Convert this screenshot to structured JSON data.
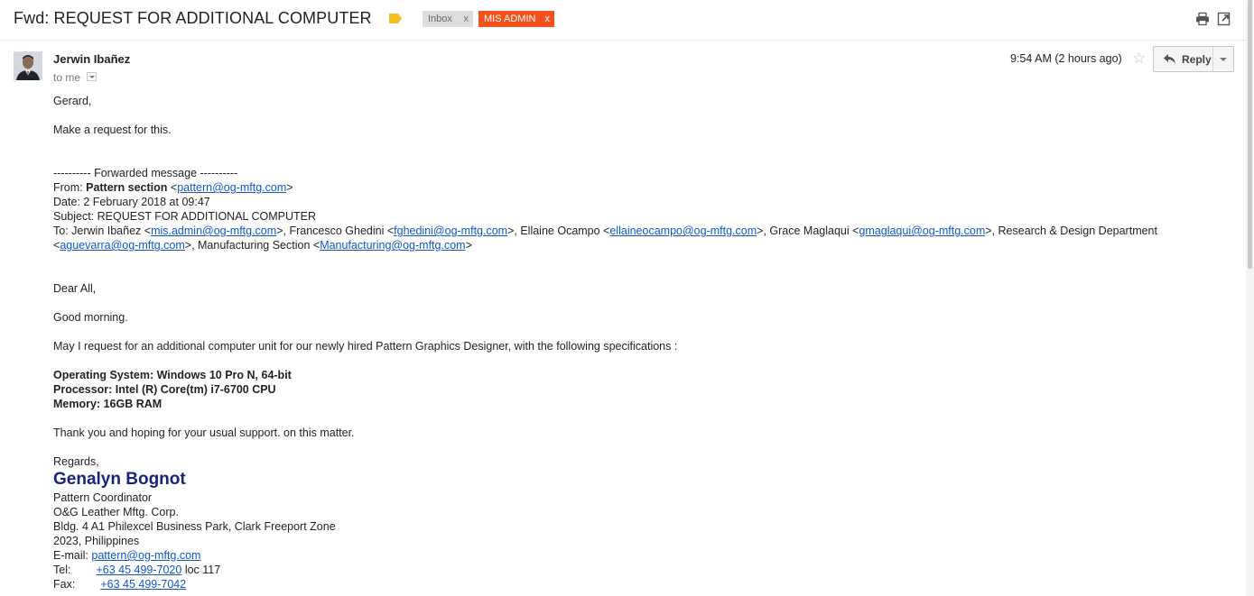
{
  "subject": {
    "title": "Fwd: REQUEST FOR ADDITIONAL COMPUTER",
    "labels": [
      {
        "name": "Inbox",
        "remove": "x"
      },
      {
        "name": "MIS ADMIN",
        "remove": "x"
      }
    ]
  },
  "icons": {
    "label_tag": "label-tag-icon",
    "print": "print-icon",
    "new_window": "new-window-icon",
    "star": "star-icon",
    "reply": "reply-arrow-icon"
  },
  "colors": {
    "label_tag": "#f6bf26",
    "mis_admin_label": "#f4511e",
    "inbox_label": "#dddddd",
    "link": "#1155cc",
    "signature_name": "#1a237e"
  },
  "message": {
    "sender_name": "Jerwin Ibañez",
    "to": "to me",
    "time": "9:54 AM (2 hours ago)",
    "star": "☆",
    "reply_label": "Reply"
  },
  "body": {
    "greeting": "Gerard,",
    "line1": "Make a request for this.",
    "fwd_header": "---------- Forwarded message ----------",
    "from_label": "From: ",
    "from_name": "Pattern section",
    "from_email": "pattern@og-mftg.com",
    "date": "Date: 2 February 2018 at 09:47",
    "subject": "Subject: REQUEST FOR ADDITIONAL COMPUTER",
    "to_label": "To: ",
    "recipients": [
      {
        "name": "Jerwin Ibañez",
        "email": "mis.admin@og-mftg.com"
      },
      {
        "name": "Francesco Ghedini",
        "email": "fghedini@og-mftg.com"
      },
      {
        "name": "Ellaine Ocampo",
        "email": "ellaineocampo@og-mftg.com"
      },
      {
        "name": "Grace Maglaqui",
        "email": "gmaglaqui@og-mftg.com"
      },
      {
        "name": "Research & Design Department",
        "email": "aguevarra@og-mftg.com"
      },
      {
        "name": "Manufacturing Section",
        "email": "Manufacturing@og-mftg.com"
      }
    ],
    "dear": "Dear All,",
    "morning": "Good morning.",
    "request": "May I request for an additional computer unit for our newly hired Pattern Graphics Designer, with the following specifications :",
    "specs": [
      "Operating System: Windows 10 Pro N, 64-bit",
      "Processor: Intel (R) Core(tm) i7-6700 CPU",
      "Memory: 16GB RAM"
    ],
    "thanks": "Thank you and hoping for your usual support. on this matter.",
    "regards": "Regards,"
  },
  "signature": {
    "name": "Genalyn Bognot",
    "title": "Pattern Coordinator",
    "company": "O&G Leather Mftg. Corp.",
    "address1": "Bldg. 4 A1 Philexcel Business Park, Clark Freeport Zone",
    "address2": "2023, Philippines",
    "email_label": "E-mail:",
    "email": "pattern@og-mftg.com",
    "tel_label": "Tel:",
    "tel": "+63 45 499-7020",
    "tel_ext": "loc 117",
    "fax_label": "Fax:",
    "fax": "+63 45 499-7042"
  }
}
